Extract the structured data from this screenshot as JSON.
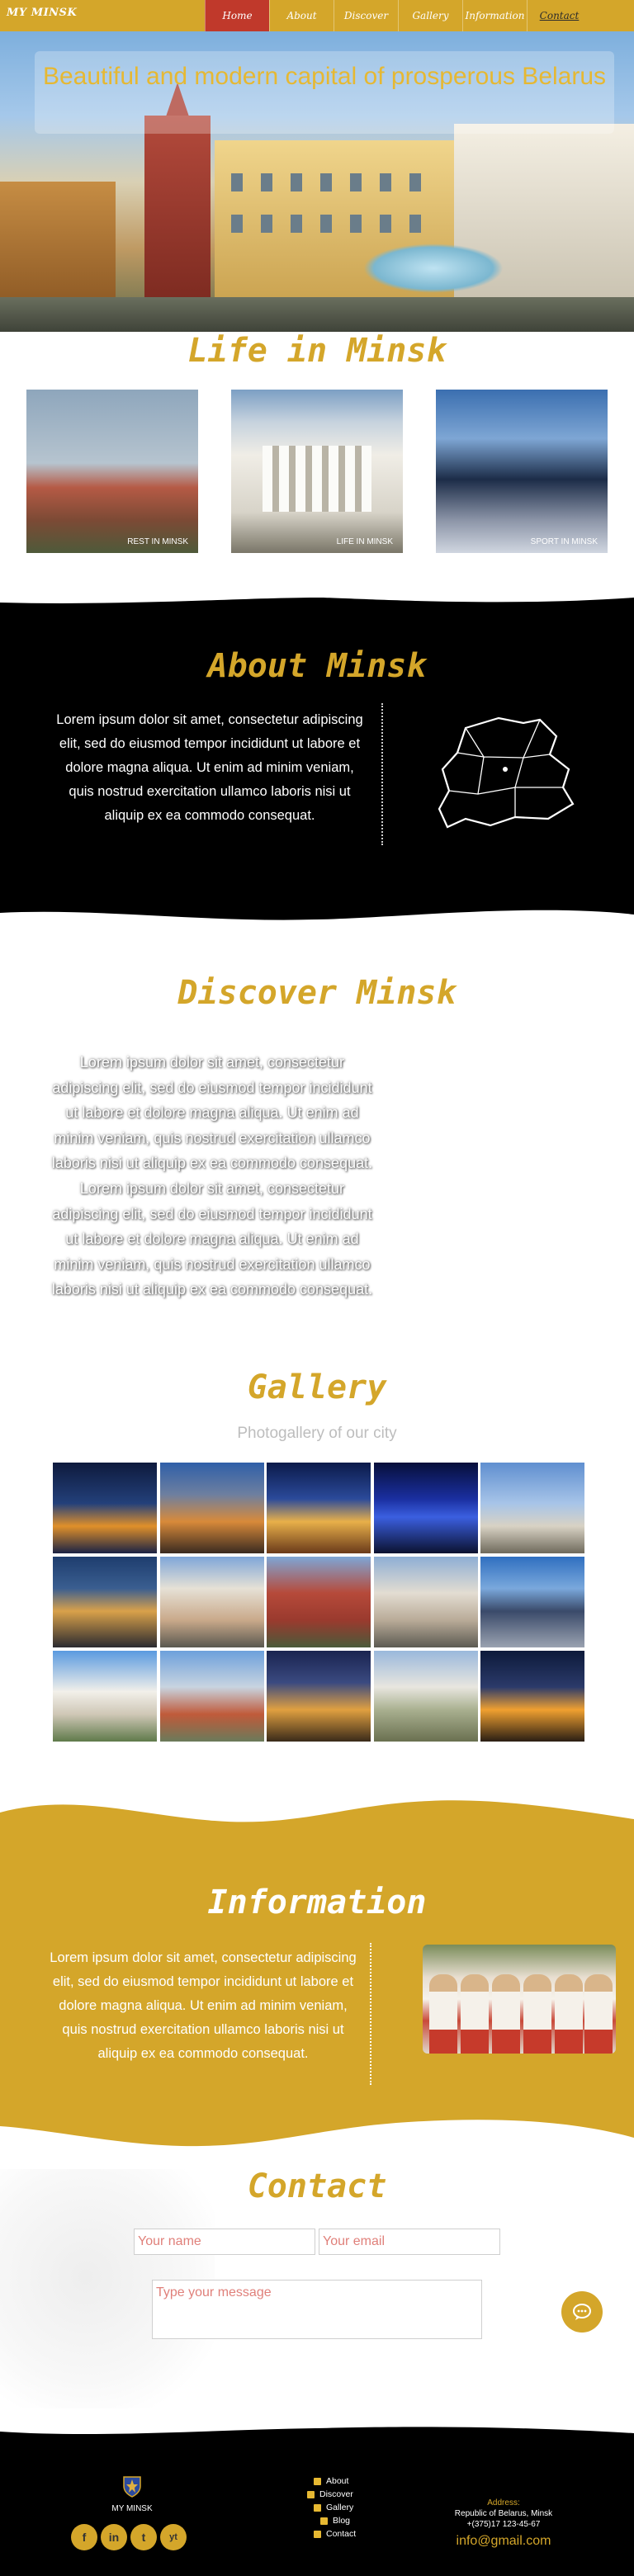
{
  "nav": {
    "logo": "MY MINSK",
    "items": [
      "Home",
      "About",
      "Discover",
      "Gallery",
      "Information",
      "Contact"
    ]
  },
  "hero": {
    "title": "Beautiful and modern capital of prosperous Belarus"
  },
  "life": {
    "title": "Life in Minsk",
    "cards": [
      {
        "caption": "REST IN MINSK"
      },
      {
        "caption": "LIFE IN MINSK"
      },
      {
        "caption": "SPORT IN MINSK"
      }
    ]
  },
  "about": {
    "title": "About Minsk",
    "text": "Lorem ipsum dolor sit amet, consectetur adipiscing elit, sed do eiusmod tempor incididunt ut labore et dolore magna aliqua. Ut enim ad minim veniam, quis nostrud exercitation ullamco laboris nisi ut aliquip ex ea commodo consequat."
  },
  "discover": {
    "title": "Discover Minsk",
    "text": "Lorem ipsum dolor sit amet, consectetur adipiscing elit, sed do eiusmod tempor incididunt ut labore et dolore magna aliqua. Ut enim ad minim veniam, quis nostrud exercitation ullamco laboris nisi ut aliquip ex ea commodo consequat. Lorem ipsum dolor sit amet, consectetur adipiscing elit, sed do eiusmod tempor incididunt ut labore et dolore magna aliqua. Ut enim ad minim veniam, quis nostrud exercitation ullamco laboris nisi ut aliquip ex ea commodo consequat."
  },
  "gallery": {
    "title": "Gallery",
    "subtitle": "Photogallery of our city"
  },
  "information": {
    "title": "Information",
    "text": "Lorem ipsum dolor sit amet, consectetur adipiscing elit, sed do eiusmod tempor incididunt ut labore et dolore magna aliqua. Ut enim ad minim veniam, quis nostrud exercitation ullamco laboris nisi ut aliquip ex ea commodo consequat."
  },
  "contact": {
    "title": "Contact",
    "name_placeholder": "Your name",
    "email_placeholder": "Your email",
    "message_placeholder": "Type your message"
  },
  "footer": {
    "logo_label": "MY MINSK",
    "socials": [
      "f",
      "in",
      "t",
      "yt"
    ],
    "links": [
      "About",
      "Discover",
      "Gallery",
      "Blog",
      "Contact"
    ],
    "address_heading": "Address:",
    "address_line1": "Republic of Belarus, Minsk",
    "phone": "+(375)17 123-45-67",
    "email": "info@gmail.com"
  },
  "colors": {
    "accent": "#d4a62a",
    "active_nav": "#c0392b",
    "dark": "#000000"
  }
}
